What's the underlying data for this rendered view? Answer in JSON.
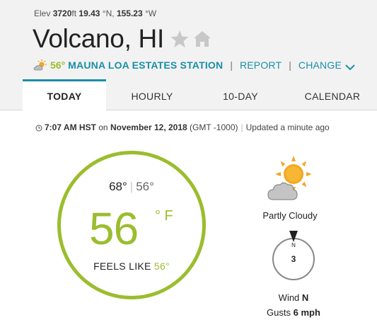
{
  "location": {
    "elev_label": "Elev",
    "elev_value": "3720",
    "elev_unit": "ft",
    "lat": "19.43",
    "lat_dir": "°N,",
    "lon": "155.23",
    "lon_dir": "°W",
    "city": "Volcano, HI"
  },
  "station": {
    "temp": "56°",
    "name": "MAUNA LOA ESTATES STATION",
    "separator": "|",
    "report_label": "REPORT",
    "change_label": "CHANGE"
  },
  "tabs": [
    {
      "label": "TODAY",
      "active": true
    },
    {
      "label": "HOURLY",
      "active": false
    },
    {
      "label": "10-DAY",
      "active": false
    },
    {
      "label": "CALENDAR",
      "active": false
    }
  ],
  "observation": {
    "time": "7:07 AM HST",
    "on": "on",
    "date": "November 12, 2018",
    "tz": "(GMT -1000)",
    "separator": "|",
    "updated": "Updated a minute ago"
  },
  "current": {
    "high": "68°",
    "separator": "|",
    "low": "56°",
    "temp": "56",
    "unit": "° F",
    "feels_label": "FEELS LIKE",
    "feels_value": "56°"
  },
  "conditions": {
    "summary": "Partly Cloudy",
    "icon": "partly-cloudy-icon"
  },
  "wind": {
    "direction_short": "N",
    "speed": "3",
    "label": "Wind",
    "direction": "N",
    "gusts_label": "Gusts",
    "gusts_value": "6 mph"
  },
  "colors": {
    "accent": "#1a8fa8",
    "temp_green": "#9bbd2e",
    "sun_orange": "#f5a623",
    "header_bg": "#f2f2f2"
  }
}
